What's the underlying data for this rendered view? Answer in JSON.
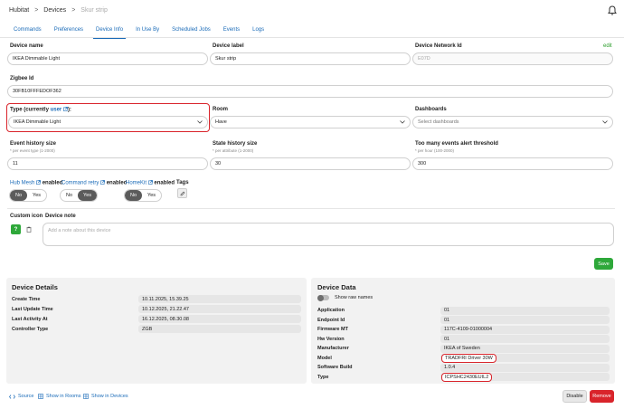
{
  "breadcrumb": {
    "root": "Hubitat",
    "section": "Devices",
    "current": "Skur strip"
  },
  "tabs": [
    {
      "label": "Commands",
      "active": false
    },
    {
      "label": "Preferences",
      "active": false
    },
    {
      "label": "Device Info",
      "active": true
    },
    {
      "label": "In Use By",
      "active": false
    },
    {
      "label": "Scheduled Jobs",
      "active": false
    },
    {
      "label": "Events",
      "active": false
    },
    {
      "label": "Logs",
      "active": false
    }
  ],
  "form": {
    "device_name_label": "Device name",
    "device_name_value": "IKEA Dimmable Light",
    "device_label_label": "Device label",
    "device_label_value": "Skur strip",
    "network_id_label": "Device Network Id",
    "network_id_placeholder": "E07D",
    "edit_link": "edit",
    "zigbee_id_label": "Zigbee Id",
    "zigbee_id_value": "30FB10FFFEDOF362",
    "type_label_prefix": "Type (currently ",
    "type_label_link": "user",
    "type_label_suffix": "):",
    "type_value": "IKEA Dimmable Light",
    "room_label": "Room",
    "room_value": "Have",
    "dashboards_label": "Dashboards",
    "dashboards_placeholder": "Select dashboards",
    "event_history_label": "Event history size",
    "event_history_sub": "* per event type (1-2000)",
    "event_history_value": "11",
    "state_history_label": "State history size",
    "state_history_sub": "* per attribute (1-2000)",
    "state_history_value": "30",
    "too_many_label": "Too many events alert threshold",
    "too_many_sub": "* per hour (100-2000)",
    "too_many_value": "300",
    "hub_mesh_link": "Hub Mesh",
    "command_retry_link": "Command retry",
    "homekit_link": "HomeKit",
    "enabled_text": "enabled",
    "tags_label": "Tags",
    "toggle_no": "No",
    "toggle_yes": "Yes",
    "hub_mesh_state": "No",
    "command_retry_state": "Yes",
    "homekit_state": "No",
    "custom_icon_label": "Custom icon",
    "custom_icon_glyph": "?",
    "device_note_label": "Device note",
    "device_note_placeholder": "Add a note about this device",
    "save_label": "Save"
  },
  "device_details": {
    "title": "Device Details",
    "rows": [
      {
        "label": "Create Time",
        "value": "10.11.2025, 15.39.25"
      },
      {
        "label": "Last Update Time",
        "value": "10.12.2025, 21.22.47"
      },
      {
        "label": "Last Activity At",
        "value": "16.12.2025, 08.30.08"
      },
      {
        "label": "Controller Type",
        "value": "ZGB"
      }
    ]
  },
  "device_data": {
    "title": "Device Data",
    "raw_names_label": "Show raw names",
    "rows": [
      {
        "label": "Application",
        "value": "01"
      },
      {
        "label": "Endpoint Id",
        "value": "01"
      },
      {
        "label": "Firmware MT",
        "value": "117C-4109-01000004"
      },
      {
        "label": "Hw Version",
        "value": "01"
      },
      {
        "label": "Manufacturer",
        "value": "IKEA of Sweden"
      },
      {
        "label": "Model",
        "value": "TRADFRI Driver 30W"
      },
      {
        "label": "Software Build",
        "value": "1.0.4"
      },
      {
        "label": "Type",
        "value": "ICPSHC2430EUIL2"
      }
    ]
  },
  "footer": {
    "source": "Source",
    "show_rooms": "Show in Rooms",
    "show_devices": "Show in Devices",
    "disable": "Disable",
    "remove": "Remove"
  },
  "colors": {
    "accent": "#1a6bb8",
    "green": "#2ea83a",
    "red": "#d9242b"
  }
}
